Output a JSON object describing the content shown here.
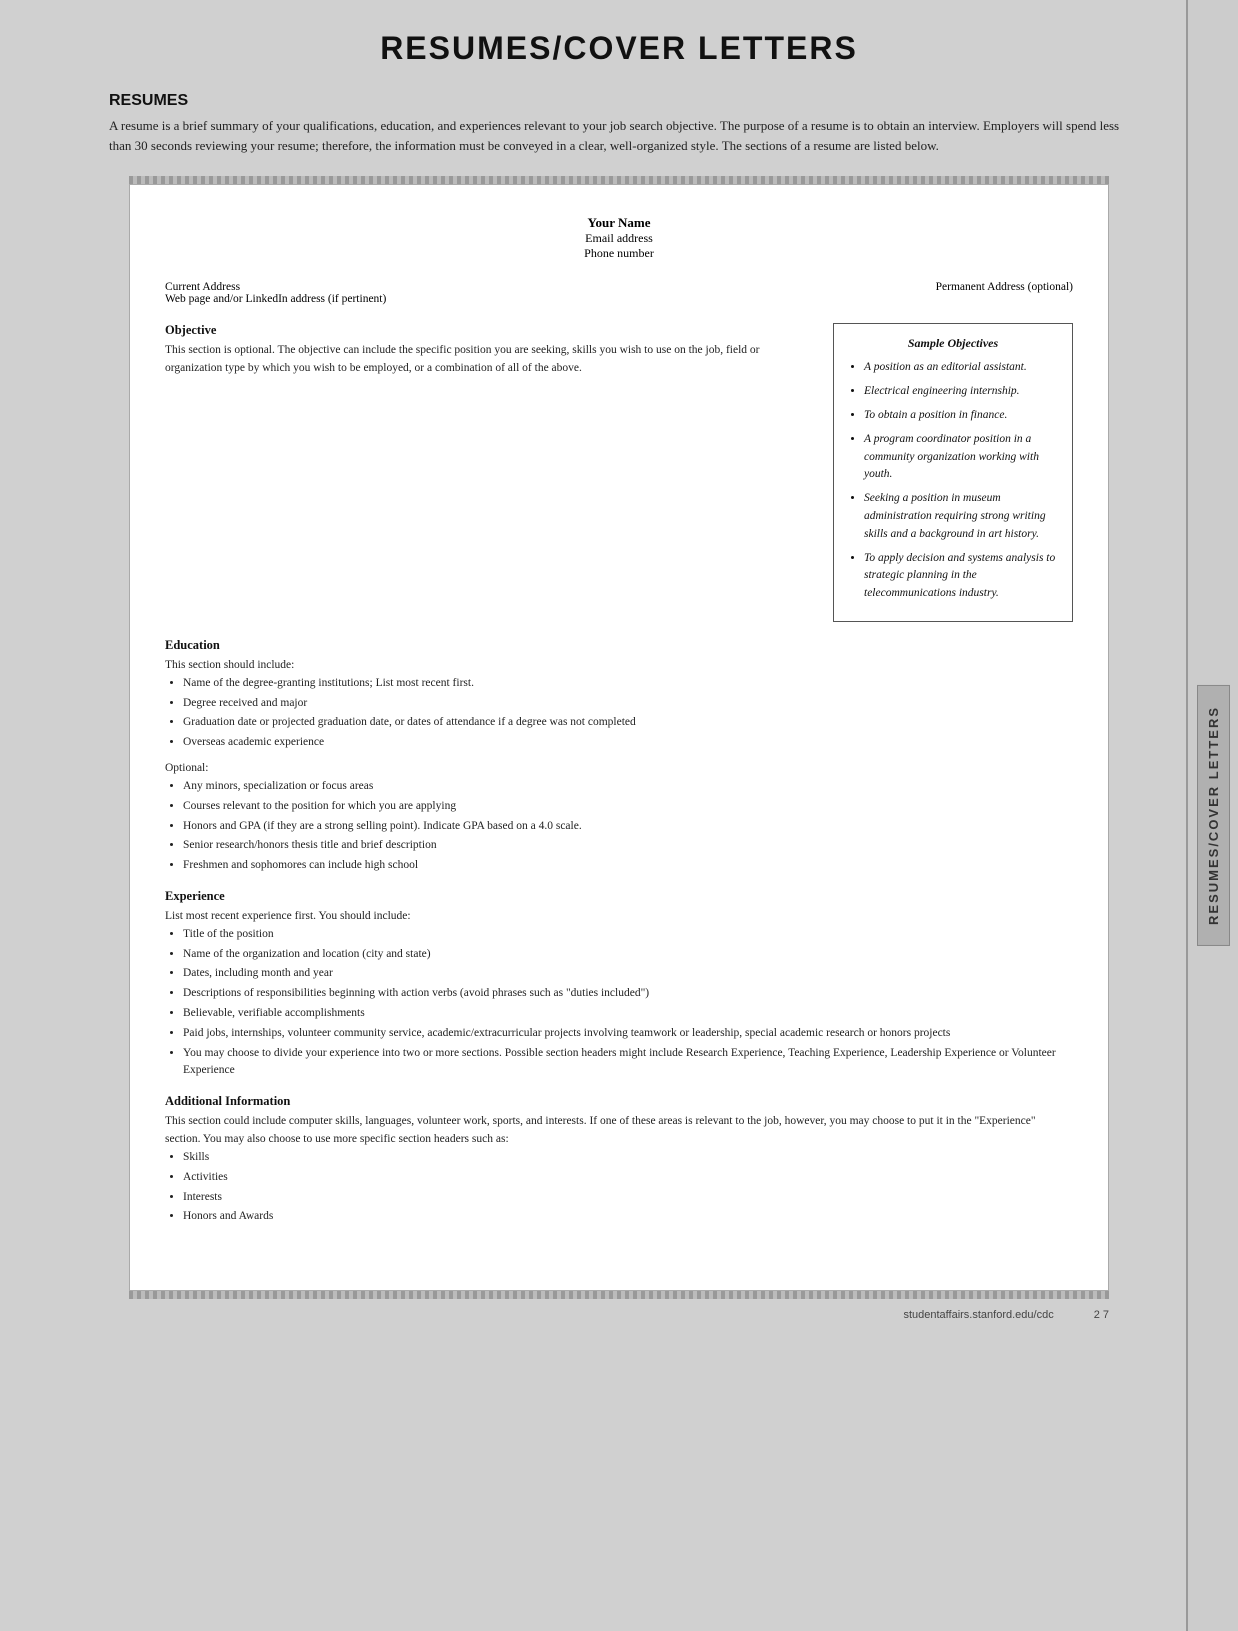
{
  "page": {
    "title": "RESUMES/COVER LETTERS",
    "side_tab_label": "RESUMES/COVER LETTERS"
  },
  "resumes_section": {
    "heading": "RESUMES",
    "intro": "A resume is a brief summary of your qualifications, education, and experiences relevant to your job search objective. The purpose of a resume is to obtain an interview. Employers will spend less than 30 seconds reviewing your resume; therefore, the information must be conveyed in a clear, well-organized style. The sections of a resume are listed below."
  },
  "document": {
    "header": {
      "name": "Your Name",
      "email": "Email address",
      "phone": "Phone number"
    },
    "address": {
      "current": "Current Address",
      "current_sub": "Web page and/or LinkedIn address (if pertinent)",
      "permanent": "Permanent Address (optional)"
    },
    "objective": {
      "title": "Objective",
      "text": "This section is optional. The objective can include the specific position you are seeking, skills you wish to use on the job, field or organization type by which you wish to be employed, or a combination of all of the above."
    },
    "sample_objectives": {
      "title": "Sample Objectives",
      "items": [
        "A position as an editorial assistant.",
        "Electrical engineering internship.",
        "To obtain a position in finance.",
        "A program coordinator position in a community organization working with youth.",
        "Seeking a position in museum administration requiring strong writing skills and a background in art history.",
        "To apply decision and systems analysis to strategic planning in the telecommunications industry."
      ]
    },
    "education": {
      "title": "Education",
      "intro": "This section should include:",
      "required_items": [
        "Name of the degree-granting institutions; List most recent first.",
        "Degree received and major",
        "Graduation date or projected graduation date, or dates of attendance if a degree was not completed",
        "Overseas academic experience"
      ],
      "optional_label": "Optional:",
      "optional_items": [
        "Any minors, specialization or focus areas",
        "Courses relevant to the position for which you are applying",
        "Honors and GPA (if they are a strong selling point). Indicate GPA based on a 4.0 scale.",
        "Senior research/honors thesis title and brief description",
        "Freshmen and sophomores can include high school"
      ]
    },
    "experience": {
      "title": "Experience",
      "intro": "List most recent experience first. You should include:",
      "items": [
        "Title of the position",
        "Name of the organization and location (city and state)",
        "Dates, including month and year",
        "Descriptions of responsibilities beginning with action verbs (avoid phrases such as \"duties included\")",
        "Believable, verifiable accomplishments",
        "Paid jobs, internships, volunteer community service, academic/extracurricular projects involving teamwork or leadership, special academic research or honors projects",
        "You may choose to divide your experience into two or more sections. Possible section headers might include Research Experience, Teaching Experience, Leadership Experience or Volunteer Experience"
      ]
    },
    "additional_info": {
      "title": "Additional Information",
      "text": "This section could include computer skills, languages, volunteer work, sports, and interests. If one of these areas is relevant to the job, however, you may choose to put it in the \"Experience\" section. You may also choose to use more specific section headers such as:",
      "items": [
        "Skills",
        "Activities",
        "Interests",
        "Honors and Awards"
      ]
    }
  },
  "footer": {
    "url": "studentaffairs.stanford.edu/cdc",
    "page": "2 7"
  }
}
